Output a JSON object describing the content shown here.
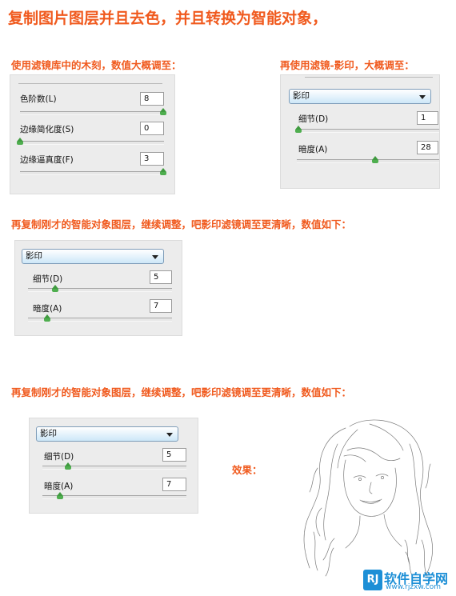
{
  "headings": {
    "main": "复制图片图层并且去色，并且转换为智能对象，",
    "step1": "使用滤镜库中的木刻，数值大概调至：",
    "step2": "再使用滤镜-影印，大概调至：",
    "step3": "再复制刚才的智能对象图层，继续调整，吧影印滤镜调至更清晰，数值如下：",
    "step4": "再复制刚才的智能对象图层，继续调整，吧影印滤镜调至更清晰，数值如下：",
    "effect": "效果："
  },
  "panel_cutout": {
    "levels_label": "色阶数(L)",
    "levels_value": "8",
    "simplicity_label": "边缘简化度(S)",
    "simplicity_value": "0",
    "fidelity_label": "边缘逼真度(F)",
    "fidelity_value": "3"
  },
  "panel_photocopy_1": {
    "filter_select": "影印",
    "detail_label": "细节(D)",
    "detail_value": "1",
    "darkness_label": "暗度(A)",
    "darkness_value": "28"
  },
  "panel_photocopy_2": {
    "filter_select": "影印",
    "detail_label": "细节(D)",
    "detail_value": "5",
    "darkness_label": "暗度(A)",
    "darkness_value": "7"
  },
  "panel_photocopy_3": {
    "filter_select": "影印",
    "detail_label": "细节(D)",
    "detail_value": "5",
    "darkness_label": "暗度(A)",
    "darkness_value": "7"
  },
  "watermark": {
    "logo": "RJ",
    "name": "软件自学网",
    "url": "www.rjzxw.com"
  },
  "colors": {
    "heading": "#f05a1e",
    "slider_thumb": "#4fae4f",
    "watermark": "#1d8fd6"
  }
}
